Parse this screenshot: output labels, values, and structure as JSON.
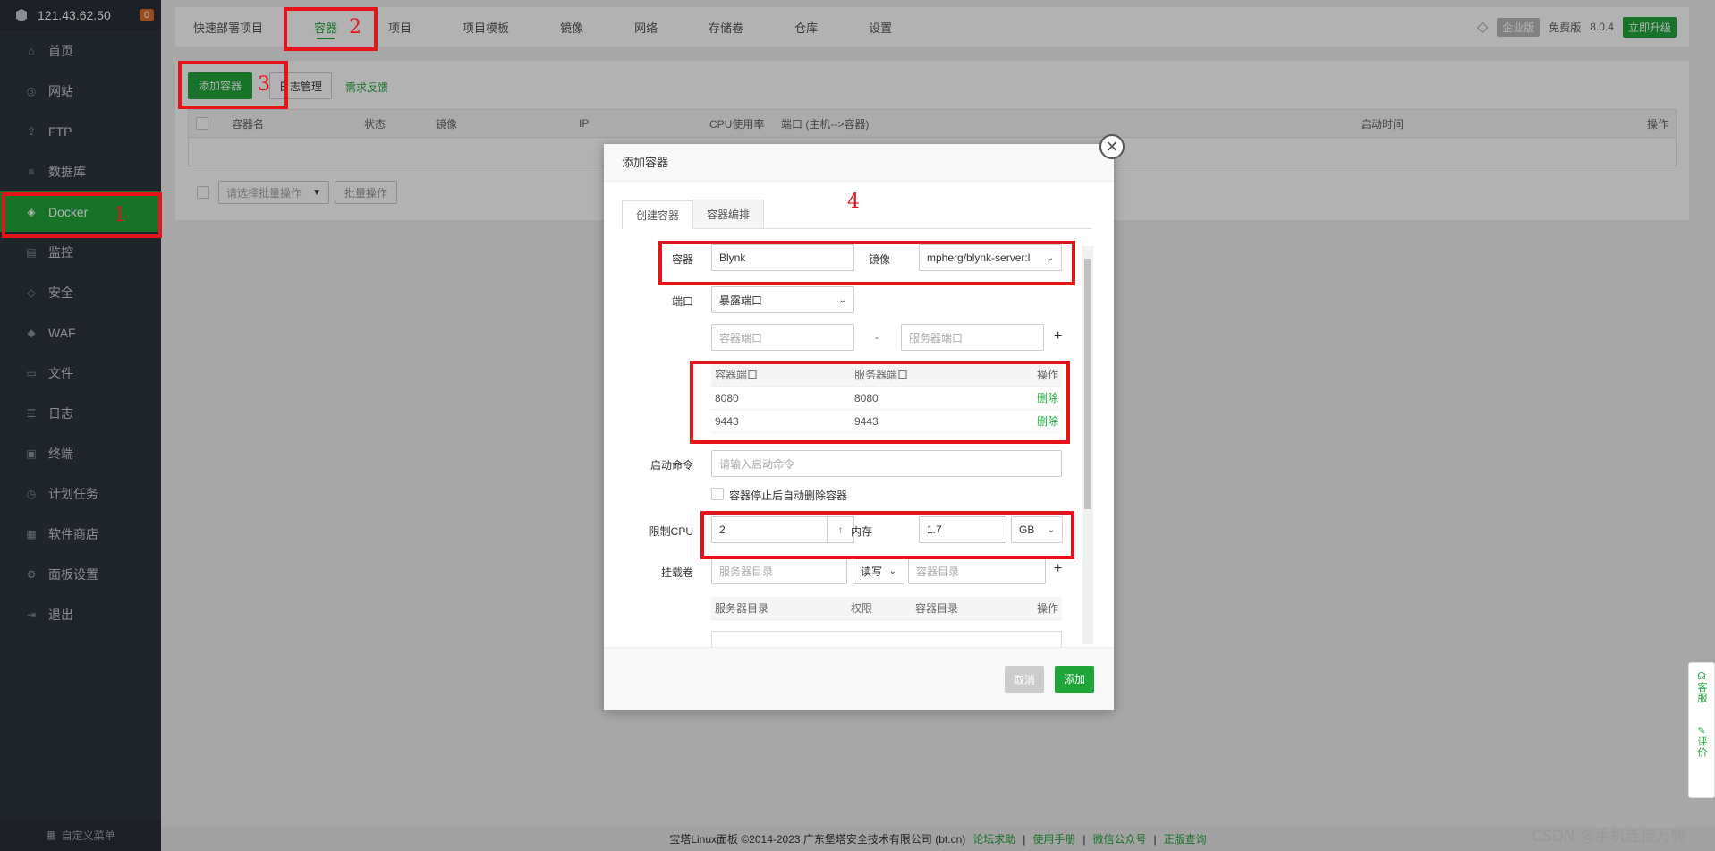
{
  "sidebar": {
    "server_ip": "121.43.62.50",
    "badge": "0",
    "items": [
      {
        "label": "首页",
        "icon": "home-icon"
      },
      {
        "label": "网站",
        "icon": "globe-icon"
      },
      {
        "label": "FTP",
        "icon": "ftp-icon"
      },
      {
        "label": "数据库",
        "icon": "database-icon"
      },
      {
        "label": "Docker",
        "icon": "docker-icon"
      },
      {
        "label": "监控",
        "icon": "monitor-icon"
      },
      {
        "label": "安全",
        "icon": "shield-icon"
      },
      {
        "label": "WAF",
        "icon": "waf-shield-icon"
      },
      {
        "label": "文件",
        "icon": "folder-icon"
      },
      {
        "label": "日志",
        "icon": "log-icon"
      },
      {
        "label": "终端",
        "icon": "terminal-icon"
      },
      {
        "label": "计划任务",
        "icon": "clock-icon"
      },
      {
        "label": "软件商店",
        "icon": "apps-icon"
      },
      {
        "label": "面板设置",
        "icon": "gear-icon"
      },
      {
        "label": "退出",
        "icon": "exit-icon"
      }
    ],
    "footer": "自定义菜单"
  },
  "topnav": {
    "tabs": [
      "快速部署项目",
      "容器",
      "项目",
      "项目模板",
      "镜像",
      "网络",
      "存储卷",
      "仓库",
      "设置"
    ],
    "enterprise": "企业版",
    "free": "免费版",
    "version": "8.0.4",
    "upgrade": "立即升级"
  },
  "toolbar": {
    "add_container": "添加容器",
    "log_manage": "日志管理",
    "feedback": "需求反馈"
  },
  "table": {
    "columns": [
      "容器名",
      "状态",
      "镜像",
      "IP",
      "CPU使用率",
      "端口 (主机-->容器)",
      "启动时间",
      "操作"
    ],
    "batch_placeholder": "请选择批量操作",
    "batch_button": "批量操作"
  },
  "modal": {
    "title": "添加容器",
    "tabs": [
      "创建容器",
      "容器编排"
    ],
    "container_label": "容器",
    "container_value": "Blynk",
    "image_label": "镜像",
    "image_value": "mpherg/blynk-server:l",
    "port_label": "端口",
    "port_mode": "暴露端口",
    "container_port_ph": "容器端口",
    "dash": "-",
    "server_port_ph": "服务器端口",
    "plus": "+",
    "port_table": {
      "headers": [
        "容器端口",
        "服务器端口",
        "操作"
      ],
      "rows": [
        {
          "container": "8080",
          "server": "8080",
          "action": "删除"
        },
        {
          "container": "9443",
          "server": "9443",
          "action": "删除"
        }
      ]
    },
    "cmd_label": "启动命令",
    "cmd_ph": "请输入启动命令",
    "autoremove": "容器停止后自动删除容器",
    "cpu_label": "限制CPU",
    "cpu_value": "2",
    "mem_label": "内存",
    "mem_value": "1.7",
    "mem_unit": "GB",
    "volume_label": "挂载卷",
    "vol_server_ph": "服务器目录",
    "vol_mode": "读写",
    "vol_container_ph": "容器目录",
    "vol_table_headers": [
      "服务器目录",
      "权限",
      "容器目录",
      "操作"
    ],
    "cancel": "取消",
    "add": "添加"
  },
  "annotations": [
    "1",
    "2",
    "3",
    "4"
  ],
  "footer": {
    "copyright": "宝塔Linux面板 ©2014-2023 广东堡塔安全技术有限公司 (bt.cn)",
    "links": [
      "论坛求助",
      "使用手册",
      "微信公众号",
      "正版查询"
    ],
    "sep": "|"
  },
  "float": {
    "service": "客服",
    "rate": "评价"
  },
  "watermark": "CSDN @手机连接万物",
  "colors": {
    "accent": "#20a53a",
    "annotation": "#e5141b",
    "sidebar": "#2f3640"
  }
}
